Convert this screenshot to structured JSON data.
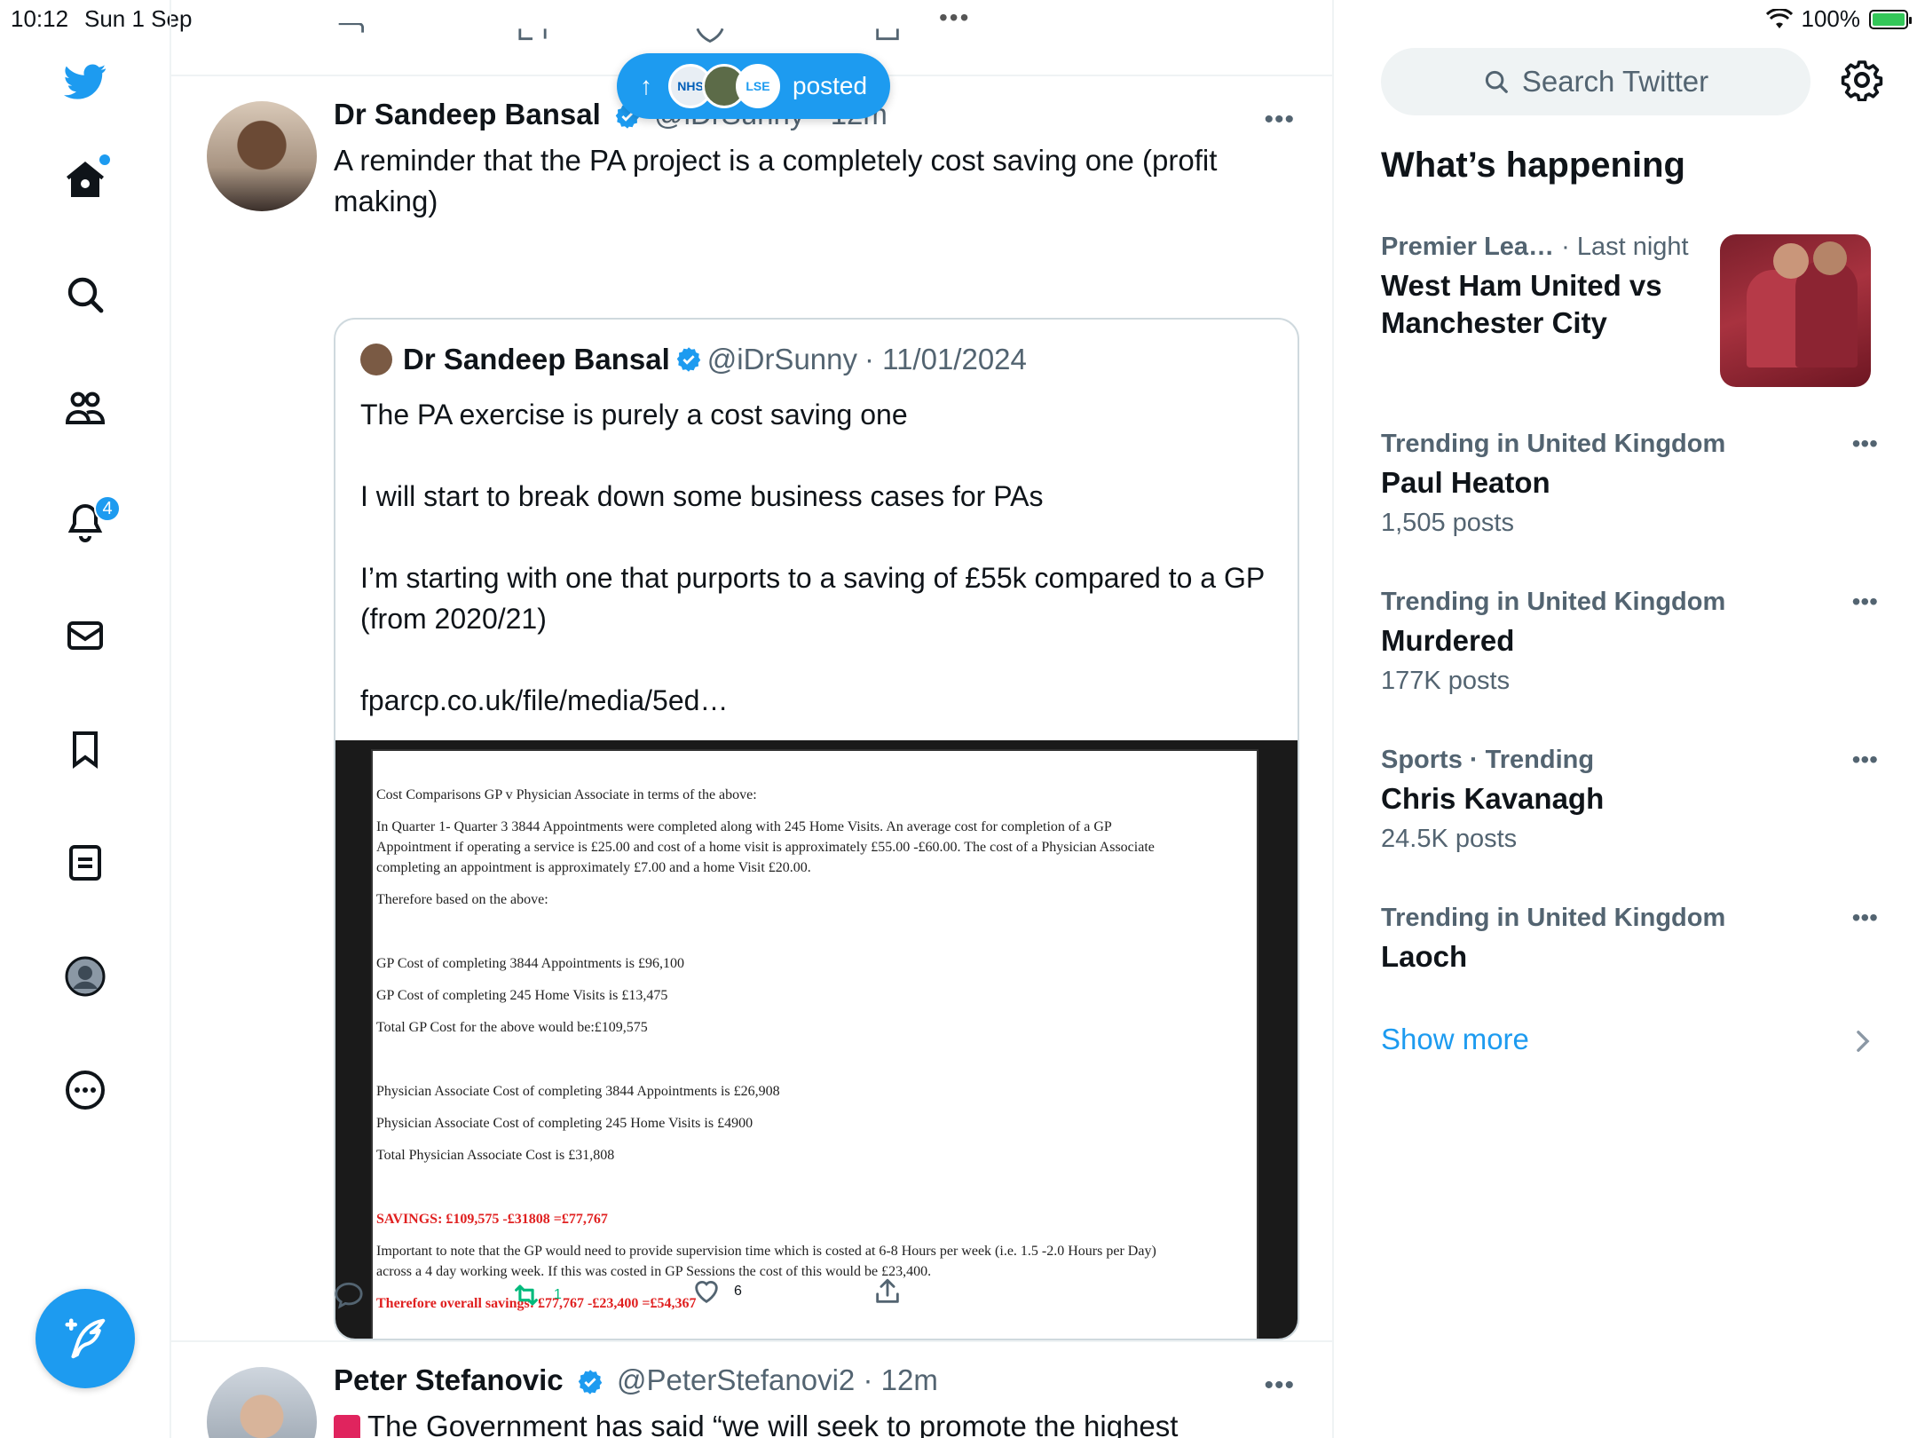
{
  "status_bar": {
    "time": "10:12",
    "date": "Sun 1 Sep",
    "battery": "100%",
    "top_dots": "•••"
  },
  "nav": {
    "items": [
      "twitter-logo",
      "home-icon",
      "search-icon",
      "communities-icon",
      "notifications-icon",
      "messages-icon",
      "bookmarks-icon",
      "lists-icon",
      "profile-icon",
      "more-icon"
    ],
    "notifications_badge": "4",
    "compose_icon": "compose-icon"
  },
  "timeline": {
    "new_posts_pill": {
      "arrow": "↑",
      "label": "posted",
      "avatars": [
        "NHS",
        "",
        "LSE"
      ]
    },
    "tweets": [
      {
        "name": "Dr Sandeep Bansal",
        "handle": "@iDrSunny",
        "time": "· 12m",
        "text": "A reminder that the PA project is a completely cost saving one (profit making)",
        "more": "•••",
        "quote": {
          "name": "Dr Sandeep Bansal",
          "handle": "@iDrSunny",
          "date": "· 11/01/2024",
          "paragraphs": [
            "The PA exercise is purely a cost saving one",
            "I will start to break down some business cases for PAs",
            "I’m starting with one that purports to a saving of £55k compared to a GP (from 2020/21)",
            "fparcp.co.uk/file/media/5ed…"
          ],
          "image_lines": [
            "Cost Comparisons GP v Physician Associate in terms of the above:",
            "In Quarter 1- Quarter 3 3844 Appointments were completed along with 245 Home Visits. An average cost for completion of a GP",
            "Appointment if operating a service is £25.00 and cost of a home visit is approximately £55.00 -£60.00. The cost of a Physician Associate",
            "completing an appointment is approximately £7.00 and a home Visit £20.00.",
            "Therefore based on the above:",
            "GP Cost of completing 3844 Appointments is £96,100",
            "GP Cost of completing 245 Home Visits is £13,475",
            "Total GP Cost for the above would be:£109,575",
            "Physician Associate Cost of completing 3844 Appointments is £26,908",
            "Physician Associate Cost of completing 245 Home Visits is £4900",
            "Total Physician Associate Cost is £31,808",
            "SAVINGS: £109,575 -£31808 =£77,767",
            "Important to note that the GP would need to provide supervision time which is costed at 6-8  Hours per week (i.e. 1.5 -2.0 Hours per Day)",
            "across a 4 day working week. If this was costed in GP Sessions the cost of this would be £23,400.",
            "Therefore overall savings: £77,767 -£23,400 =£54,367"
          ]
        },
        "retweets": "1",
        "likes": "6"
      },
      {
        "name": "Peter Stefanovic",
        "handle": "@PeterStefanovi2",
        "time": "· 12m",
        "text": "The Government has said “we will seek to promote the highest",
        "more": "•••"
      }
    ]
  },
  "sidebar": {
    "search_placeholder": "Search Twitter",
    "title": "What’s happening",
    "trends": [
      {
        "category": "Premier Lea…",
        "suffix": "· Last night",
        "title": "West Ham United vs Manchester City",
        "posts": ""
      },
      {
        "category": "Trending in United Kingdom",
        "suffix": "",
        "title": "Paul Heaton",
        "posts": "1,505 posts"
      },
      {
        "category": "Trending in United Kingdom",
        "suffix": "",
        "title": "Murdered",
        "posts": "177K posts"
      },
      {
        "category": "Sports · Trending",
        "suffix": "",
        "title": "Chris Kavanagh",
        "posts": "24.5K posts"
      },
      {
        "category": "Trending in United Kingdom",
        "suffix": "",
        "title": "Laoch",
        "posts": ""
      }
    ],
    "trend_more": "•••",
    "show_more": "Show more"
  },
  "colors": {
    "accent": "#1d9bf0",
    "retweet": "#00ba7c",
    "muted": "#536471",
    "border": "#eff3f4",
    "red_text": "#e02020"
  }
}
